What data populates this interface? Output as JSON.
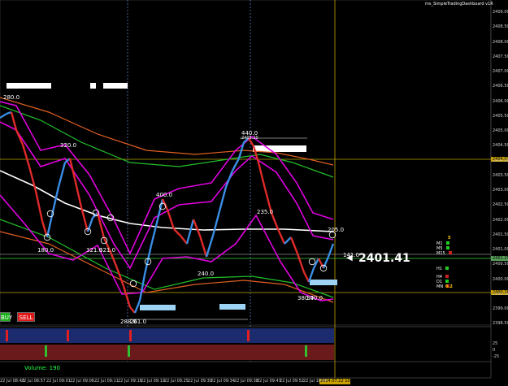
{
  "window": {
    "title": "ms_SimpleTradingDashboard v1R"
  },
  "price_axis": {
    "labels": [
      "2409.00",
      "2408.50",
      "2408.00",
      "2407.50",
      "2407.00",
      "2406.50",
      "2406.00",
      "2405.50",
      "2405.00",
      "2404.50",
      "2404.00",
      "2403.50",
      "2403.00",
      "2402.50",
      "2402.00",
      "2401.50",
      "2401.00",
      "2400.50",
      "2400.00",
      "2399.50",
      "2399.00",
      "2398.50"
    ],
    "tags": [
      "2404.07",
      "2401.25",
      "2400.16"
    ],
    "tag_colors": [
      "#c8a000",
      "#7ad07a",
      "#c8a000"
    ]
  },
  "time_axis": {
    "labels": [
      "22 Jul 08:43",
      "22 Jul 08:57",
      "22 Jul 09:01",
      "22 Jul 09:06",
      "22 Jul 09:11",
      "22 Jul 09:16",
      "22 Jul 09:19",
      "22 Jul 09:25",
      "22 Jul 09:30",
      "22 Jul 09:34",
      "22 Jul 09:38",
      "22 Jul 09:47",
      "22 Jul 09:52",
      "22 Jul 10:00",
      "22 Jul",
      "2024.07.22 10:05"
    ]
  },
  "current_price": "2401.41",
  "chart_labels": {
    "labels": [
      "280.0",
      "320.0",
      "180.0",
      "321.0",
      "321.0",
      "400.0",
      "240.0",
      "440.0",
      "2405.20",
      "235.0",
      "205.0",
      "141.0",
      "288.0",
      "261.0",
      "380.0",
      "340.0"
    ]
  },
  "buttons": {
    "buy": "BUY",
    "sell": "SELL"
  },
  "dashboard": {
    "signals": [
      "M1",
      "M5",
      "M15",
      "H1",
      "H4",
      "D1",
      "MN"
    ],
    "signal_colors": [
      "#22cc22",
      "#22cc22",
      "#cc2222",
      "#22cc22",
      "#cc2222",
      "#22cc22",
      "#cc2222"
    ],
    "status_value": "5",
    "status_value2": "0.2",
    "rows": [
      "M1",
      "M5",
      "M15",
      "H1",
      "H4",
      "D1",
      "W1",
      "MN"
    ]
  },
  "volume": {
    "label": "Volume:",
    "value": "190"
  },
  "subwindow": {
    "labels": [
      "25",
      "0",
      "-25"
    ]
  },
  "colors": {
    "up": "#3a8ee6",
    "down": "#e02a2a",
    "band": "#e000e0",
    "ma_green": "#22c02a",
    "ma_orange": "#e06020",
    "ma_white": "#ffffff",
    "level": "#b8a800"
  }
}
